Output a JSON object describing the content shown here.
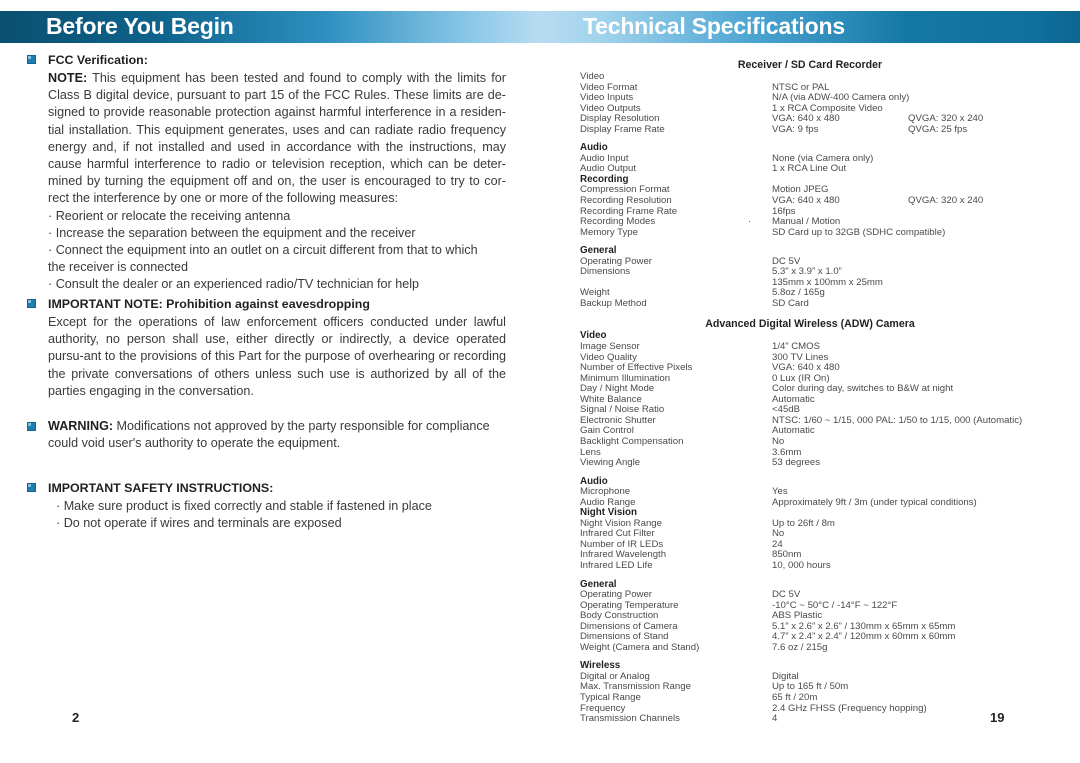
{
  "header": {
    "left_title": "Before You  Begin",
    "right_title": "Technical Specifications",
    "gradient_dark": "#0a5070",
    "gradient_light": "#b7dcf1",
    "accent": "#1c7fb0"
  },
  "left_page": {
    "page_number": "2",
    "sections": [
      {
        "heading": "FCC Verification:",
        "body_lead": "NOTE:",
        "body": " This equipment has been tested and found to comply with the limits for Class B digital device, pursuant to part 15 of the FCC Rules. These limits are de-signed to provide reasonable protection against harmful interference in a residen-tial installation. This equipment generates, uses and can radiate radio frequency energy and, if not installed and used in accordance with the instructions, may cause harmful interference to radio or television reception, which can be deter-mined by turning the equipment off and on, the user is encouraged to try to cor-rect the interference by one or more of the following measures:",
        "bullets": [
          "· Reorient or relocate the receiving antenna",
          "· Increase the separation between the equipment and the receiver",
          "· Connect the equipment into an outlet on a circuit different from that to which",
          "the receiver is connected",
          "· Consult the dealer or an experienced radio/TV technician for help"
        ]
      },
      {
        "heading": "IMPORTANT NOTE: Prohibition against eavesdropping",
        "body": "Except for the operations of law enforcement officers conducted under lawful authority, no person shall use, either directly or indirectly, a device operated pursu-ant to the provisions of this Part for the purpose of overhearing or recording the private conversations of others unless such use is authorized by all of the parties engaging in the conversation."
      },
      {
        "body_lead": "WARNING:",
        "body": " Modifications not approved by the party responsible for compliance could void user's authority to operate the equipment."
      },
      {
        "heading": "IMPORTANT SAFETY INSTRUCTIONS:",
        "bullets": [
          "· Make sure product is fixed correctly and stable if fastened in place",
          "· Do not operate if wires and terminals are exposed"
        ]
      }
    ]
  },
  "right_page": {
    "page_number": "19",
    "spec_tables": [
      {
        "title": "Receiver / SD Card Recorder",
        "rows": [
          {
            "type": "plain-head",
            "label": "Video"
          },
          {
            "type": "row",
            "label": "Video Format",
            "value": "NTSC or PAL"
          },
          {
            "type": "row",
            "label": "Video Inputs",
            "value": "N/A (via ADW-400 Camera only)"
          },
          {
            "type": "row",
            "label": "Video Outputs",
            "value": "1 x RCA Composite Video"
          },
          {
            "type": "row",
            "label": "Display Resolution",
            "value": "VGA: 640 x 480",
            "value2": "QVGA: 320 x 240"
          },
          {
            "type": "row",
            "label": "Display Frame Rate",
            "value": "VGA: 9 fps",
            "value2": "QVGA: 25 fps"
          },
          {
            "type": "gap"
          },
          {
            "type": "head",
            "label": "Audio"
          },
          {
            "type": "row",
            "label": "Audio Input",
            "value": "None (via Camera only)"
          },
          {
            "type": "row",
            "label": "Audio Output",
            "value": "1 x RCA Line Out"
          },
          {
            "type": "head",
            "label": "Recording"
          },
          {
            "type": "row",
            "label": "Compression Format",
            "value": "Motion JPEG"
          },
          {
            "type": "row",
            "label": "Recording Resolution",
            "value": "VGA: 640 x 480",
            "value2": "QVGA: 320 x 240"
          },
          {
            "type": "row",
            "label": "Recording Frame Rate",
            "value": "16fps"
          },
          {
            "type": "row",
            "label": "Recording Modes",
            "value": "Manual / Motion",
            "dot": "·"
          },
          {
            "type": "row",
            "label": "Memory Type",
            "value": "SD Card up to 32GB (SDHC compatible)"
          },
          {
            "type": "gap"
          },
          {
            "type": "head",
            "label": "General"
          },
          {
            "type": "row",
            "label": "Operating Power",
            "value": "DC 5V"
          },
          {
            "type": "row",
            "label": "Dimensions",
            "value": "5.3” x 3.9” x 1.0”"
          },
          {
            "type": "row",
            "label": "",
            "value": "135mm x 100mm x 25mm"
          },
          {
            "type": "row",
            "label": "Weight",
            "value": "5.8oz / 165g"
          },
          {
            "type": "row",
            "label": "Backup Method",
            "value": "SD Card"
          }
        ]
      },
      {
        "title": "Advanced Digital Wireless (ADW) Camera",
        "rows": [
          {
            "type": "head",
            "label": "Video"
          },
          {
            "type": "row",
            "label": "Image Sensor",
            "value": "1/4” CMOS"
          },
          {
            "type": "row",
            "label": "Video Quality",
            "value": "300 TV Lines"
          },
          {
            "type": "row",
            "label": "Number of Effective Pixels",
            "value": "VGA: 640 x 480"
          },
          {
            "type": "row",
            "label": "Minimum Illumination",
            "value": "0 Lux (IR On)"
          },
          {
            "type": "row",
            "label": "Day / Night Mode",
            "value": "Color during day, switches to B&W at night"
          },
          {
            "type": "row",
            "label": "White Balance",
            "value": "Automatic"
          },
          {
            "type": "row",
            "label": "Signal / Noise Ratio",
            "value": "<45dB"
          },
          {
            "type": "row",
            "label": "Electronic Shutter",
            "value": "NTSC: 1/60 ~ 1/15, 000 PAL: 1/50 to 1/15, 000 (Automatic)"
          },
          {
            "type": "row",
            "label": "Gain Control",
            "value": "Automatic"
          },
          {
            "type": "row",
            "label": "Backlight Compensation",
            "value": "No"
          },
          {
            "type": "row",
            "label": "Lens",
            "value": "3.6mm"
          },
          {
            "type": "row",
            "label": "Viewing Angle",
            "value": "53 degrees"
          },
          {
            "type": "gap"
          },
          {
            "type": "head",
            "label": "Audio"
          },
          {
            "type": "row",
            "label": "Microphone",
            "value": "Yes"
          },
          {
            "type": "row",
            "label": "Audio Range",
            "value": "Approximately 9ft / 3m (under typical conditions)"
          },
          {
            "type": "head",
            "label": "Night Vision"
          },
          {
            "type": "row",
            "label": "Night Vision Range",
            "value": "Up to 26ft / 8m"
          },
          {
            "type": "row",
            "label": "Infrared Cut Filter",
            "value": "No"
          },
          {
            "type": "row",
            "label": "Number of IR LEDs",
            "value": "24"
          },
          {
            "type": "row",
            "label": "Infrared Wavelength",
            "value": "850nm"
          },
          {
            "type": "row",
            "label": "Infrared LED Life",
            "value": "10, 000 hours"
          },
          {
            "type": "gap"
          },
          {
            "type": "head",
            "label": "General"
          },
          {
            "type": "row",
            "label": "Operating Power",
            "value": "DC 5V"
          },
          {
            "type": "row",
            "label": "Operating Temperature",
            "value": "-10°C ~ 50°C / -14°F ~ 122°F"
          },
          {
            "type": "row",
            "label": "Body Construction",
            "value": "ABS Plastic"
          },
          {
            "type": "row",
            "label": "Dimensions of Camera",
            "value": "5.1” x 2.6” x 2.6” / 130mm x 65mm x 65mm"
          },
          {
            "type": "row",
            "label": "Dimensions of Stand",
            "value": "4.7” x 2.4” x 2.4” / 120mm x 60mm x 60mm"
          },
          {
            "type": "row",
            "label": "Weight (Camera and Stand)",
            "value": "7.6 oz / 215g"
          },
          {
            "type": "gap"
          },
          {
            "type": "head",
            "label": "Wireless"
          },
          {
            "type": "row",
            "label": "Digital or Analog",
            "value": "Digital"
          },
          {
            "type": "row",
            "label": "Max. Transmission Range",
            "value": "Up to 165 ft / 50m"
          },
          {
            "type": "row",
            "label": "Typical Range",
            "value": "65 ft / 20m"
          },
          {
            "type": "row",
            "label": "Frequency",
            "value": "2.4 GHz FHSS (Frequency hopping)"
          },
          {
            "type": "row",
            "label": "Transmission Channels",
            "value": "4"
          }
        ]
      }
    ]
  }
}
